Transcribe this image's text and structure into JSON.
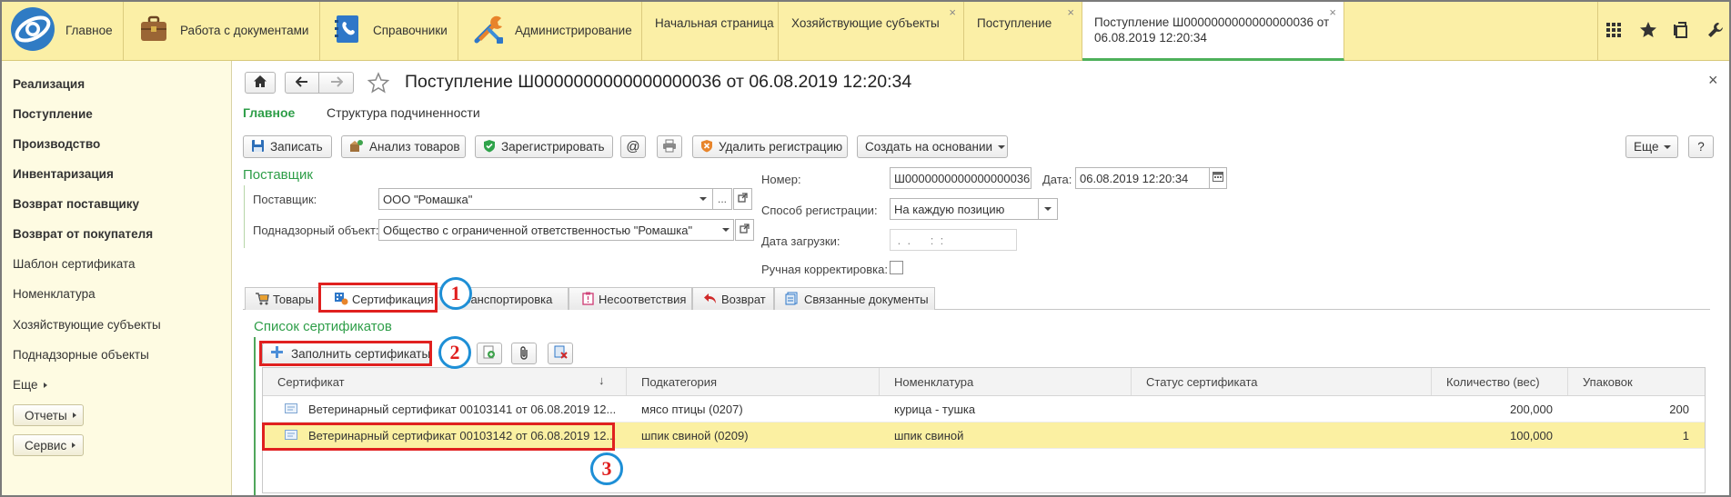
{
  "top_panel": {
    "home": {
      "label": "Главное",
      "icon": "1c-logo-icon"
    },
    "sections": [
      {
        "label": "Работа с документами",
        "icon": "briefcase-icon"
      },
      {
        "label": "Справочники",
        "icon": "address-book-icon"
      },
      {
        "label": "Администрирование",
        "icon": "tools-icon"
      }
    ],
    "tabs": [
      {
        "label": "Начальная страница"
      },
      {
        "label": "Хозяйствующие субъекты",
        "close": "×"
      },
      {
        "label": "Поступление",
        "close": "×"
      },
      {
        "label_line1": "Поступление Ш0000000000000000036 от",
        "label_line2": "06.08.2019 12:20:34",
        "close": "×",
        "active": true
      }
    ],
    "tools": [
      "grid-icon",
      "star-icon",
      "copy-icon",
      "wrench-icon"
    ]
  },
  "sidebar": {
    "items": [
      {
        "label": "Реализация"
      },
      {
        "label": "Поступление"
      },
      {
        "label": "Производство"
      },
      {
        "label": "Инвентаризация"
      },
      {
        "label": "Возврат поставщику"
      },
      {
        "label": "Возврат от покупателя"
      },
      {
        "label": "Шаблон сертификата"
      },
      {
        "label": "Номенклатура"
      },
      {
        "label": "Хозяйствующие субъекты"
      },
      {
        "label": "Поднадзорные объекты"
      }
    ],
    "more": "Еще",
    "buttons": [
      {
        "label": "Отчеты"
      },
      {
        "label": "Сервис"
      }
    ]
  },
  "document": {
    "title": "Поступление Ш0000000000000000036 от 06.08.2019 12:20:34",
    "close": "×",
    "nav": [
      {
        "label": "Главное",
        "active": true
      },
      {
        "label": "Структура подчиненности"
      }
    ],
    "toolbar": {
      "save": "Записать",
      "analyze": "Анализ товаров",
      "register": "Зарегистрировать",
      "email": "@",
      "delete_registration": "Удалить регистрацию",
      "create_based_on": "Создать на основании",
      "more": "Еще",
      "help": "?"
    },
    "supplier_group": {
      "title": "Поставщик",
      "supplier": {
        "label": "Поставщик:",
        "value": "ООО \"Ромашка\""
      },
      "object": {
        "label": "Поднадзорный объект:",
        "value": "Общество с ограниченной ответственностью \"Ромашка\""
      },
      "select_glyph": "..."
    },
    "header_fields": {
      "number": {
        "label": "Номер:",
        "value": "Ш0000000000000000036"
      },
      "date": {
        "label": "Дата:",
        "value": "06.08.2019 12:20:34"
      },
      "registration_method": {
        "label": "Способ регистрации:",
        "value": "На каждую позицию"
      },
      "load_date": {
        "label": "Дата загрузки:",
        "value": " .  .      :  : "
      },
      "manual_correction": {
        "label": "Ручная корректировка:",
        "checked": false
      }
    },
    "tabs": [
      {
        "label": "Товары",
        "icon": "cart-icon"
      },
      {
        "label": "Сертификация",
        "icon": "certificate-icon",
        "active": true
      },
      {
        "label": "Транспортировка",
        "icon": "truck-icon"
      },
      {
        "label": "Несоответствия",
        "icon": "clipboard-icon"
      },
      {
        "label": "Возврат",
        "icon": "return-arrow-icon"
      },
      {
        "label": "Связанные документы",
        "icon": "linked-docs-icon"
      }
    ],
    "certificates": {
      "title": "Список сертификатов",
      "fill_button": "Заполнить сертификаты",
      "sort_glyph": "↓",
      "columns": [
        "Сертификат",
        "Подкатегория",
        "Номенклатура",
        "Статус сертификата",
        "Количество (вес)",
        "Упаковок"
      ],
      "rows": [
        {
          "certificate": "Ветеринарный сертификат 00103141 от 06.08.2019 12...",
          "subcategory": "мясо птицы (0207)",
          "nomenclature": "курица - тушка",
          "status": "",
          "quantity": "200,000",
          "packages": "200",
          "selected": false
        },
        {
          "certificate": "Ветеринарный сертификат 00103142 от 06.08.2019 12...",
          "subcategory": "шпик свиной (0209)",
          "nomenclature": "шпик свиной",
          "status": "",
          "quantity": "100,000",
          "packages": "1",
          "selected": true
        }
      ]
    }
  },
  "annotations": [
    {
      "number": "1"
    },
    {
      "number": "2"
    },
    {
      "number": "3"
    }
  ],
  "colors": {
    "accent_green": "#2E9E48",
    "panel_yellow": "#FBEFA6",
    "sidebar_bg": "#FEFBE2",
    "selected_row": "#FBF0A2",
    "annotation_red": "#E0201F",
    "annotation_blue": "#1E8FD6"
  }
}
